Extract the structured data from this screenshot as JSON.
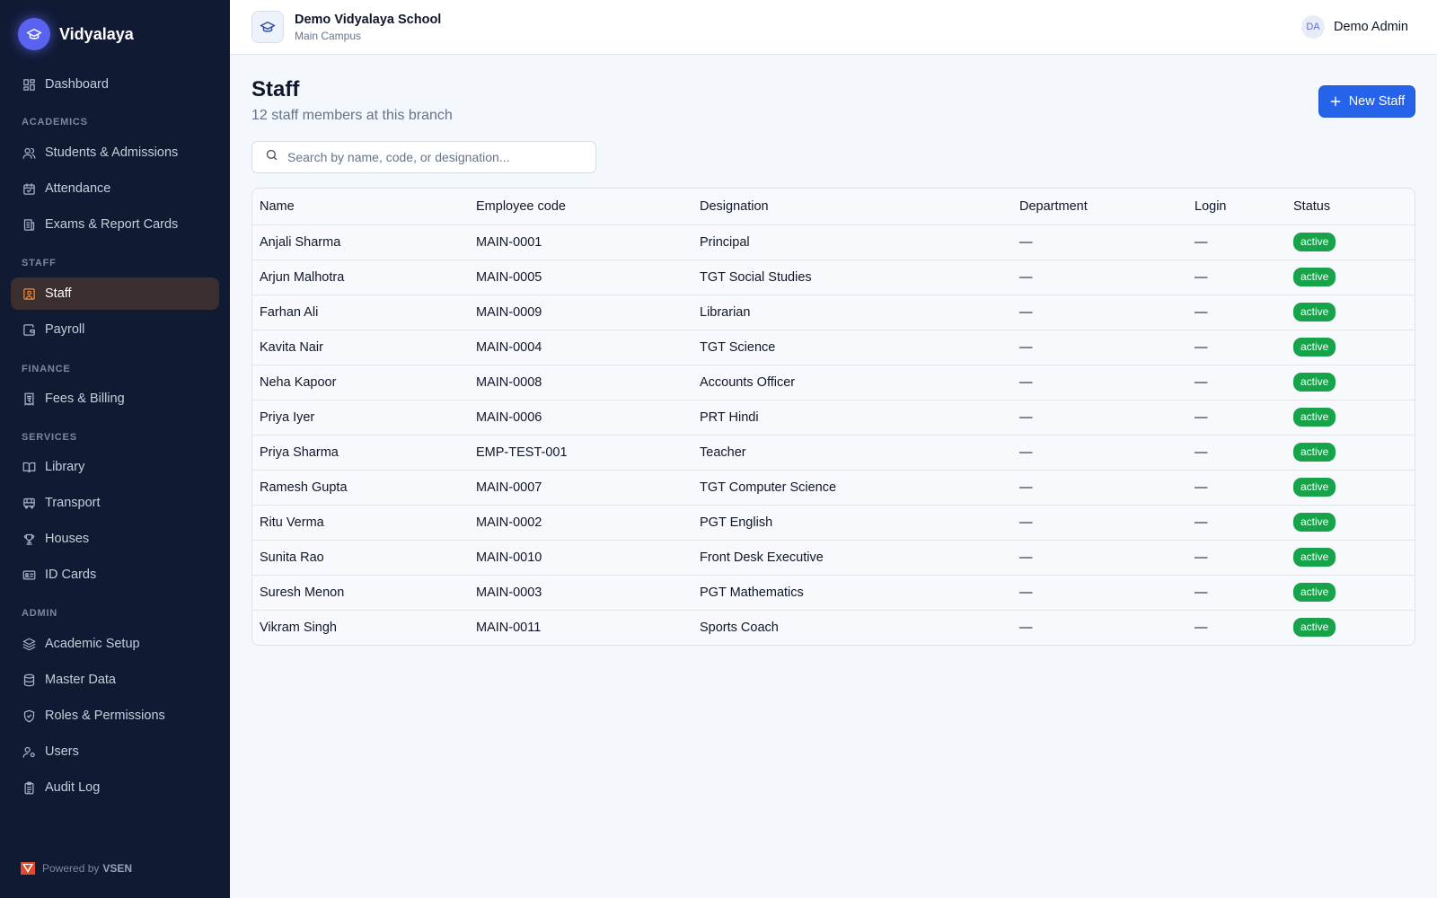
{
  "sidebar": {
    "brand": "Vidyalaya",
    "dashboard": "Dashboard",
    "sections": {
      "academics": "ACADEMICS",
      "staff": "STAFF",
      "finance": "FINANCE",
      "services": "SERVICES",
      "admin": "ADMIN"
    },
    "items": {
      "students": "Students & Admissions",
      "attendance": "Attendance",
      "exams": "Exams & Report Cards",
      "staff": "Staff",
      "payroll": "Payroll",
      "fees": "Fees & Billing",
      "library": "Library",
      "transport": "Transport",
      "houses": "Houses",
      "idcards": "ID Cards",
      "academic_setup": "Academic Setup",
      "master_data": "Master Data",
      "roles": "Roles & Permissions",
      "users": "Users",
      "audit": "Audit Log"
    },
    "powered_prefix": "Powered by",
    "powered_brand": "VSEN"
  },
  "header": {
    "school_name": "Demo Vidyalaya School",
    "campus": "Main Campus",
    "user_initials": "DA",
    "user_name": "Demo Admin"
  },
  "main": {
    "title": "Staff",
    "subtitle": "12 staff members at this branch",
    "new_button": "New Staff",
    "search_placeholder": "Search by name, code, or designation...",
    "columns": {
      "name": "Name",
      "code": "Employee code",
      "designation": "Designation",
      "department": "Department",
      "login": "Login",
      "status": "Status"
    },
    "rows": [
      {
        "name": "Anjali Sharma",
        "code": "MAIN-0001",
        "designation": "Principal",
        "department": "—",
        "login": "—",
        "status": "active"
      },
      {
        "name": "Arjun Malhotra",
        "code": "MAIN-0005",
        "designation": "TGT Social Studies",
        "department": "—",
        "login": "—",
        "status": "active"
      },
      {
        "name": "Farhan Ali",
        "code": "MAIN-0009",
        "designation": "Librarian",
        "department": "—",
        "login": "—",
        "status": "active"
      },
      {
        "name": "Kavita Nair",
        "code": "MAIN-0004",
        "designation": "TGT Science",
        "department": "—",
        "login": "—",
        "status": "active"
      },
      {
        "name": "Neha Kapoor",
        "code": "MAIN-0008",
        "designation": "Accounts Officer",
        "department": "—",
        "login": "—",
        "status": "active"
      },
      {
        "name": "Priya Iyer",
        "code": "MAIN-0006",
        "designation": "PRT Hindi",
        "department": "—",
        "login": "—",
        "status": "active"
      },
      {
        "name": "Priya Sharma",
        "code": "EMP-TEST-001",
        "designation": "Teacher",
        "department": "—",
        "login": "—",
        "status": "active"
      },
      {
        "name": "Ramesh Gupta",
        "code": "MAIN-0007",
        "designation": "TGT Computer Science",
        "department": "—",
        "login": "—",
        "status": "active"
      },
      {
        "name": "Ritu Verma",
        "code": "MAIN-0002",
        "designation": "PGT English",
        "department": "—",
        "login": "—",
        "status": "active"
      },
      {
        "name": "Sunita Rao",
        "code": "MAIN-0010",
        "designation": "Front Desk Executive",
        "department": "—",
        "login": "—",
        "status": "active"
      },
      {
        "name": "Suresh Menon",
        "code": "MAIN-0003",
        "designation": "PGT Mathematics",
        "department": "—",
        "login": "—",
        "status": "active"
      },
      {
        "name": "Vikram Singh",
        "code": "MAIN-0011",
        "designation": "Sports Coach",
        "department": "—",
        "login": "—",
        "status": "active"
      }
    ]
  },
  "colors": {
    "sidebar_bg": "#111a33",
    "active_item_bg": "#3a2e2e",
    "active_icon": "#f08a3c",
    "primary": "#2563eb",
    "status_active": "#16a34a"
  }
}
